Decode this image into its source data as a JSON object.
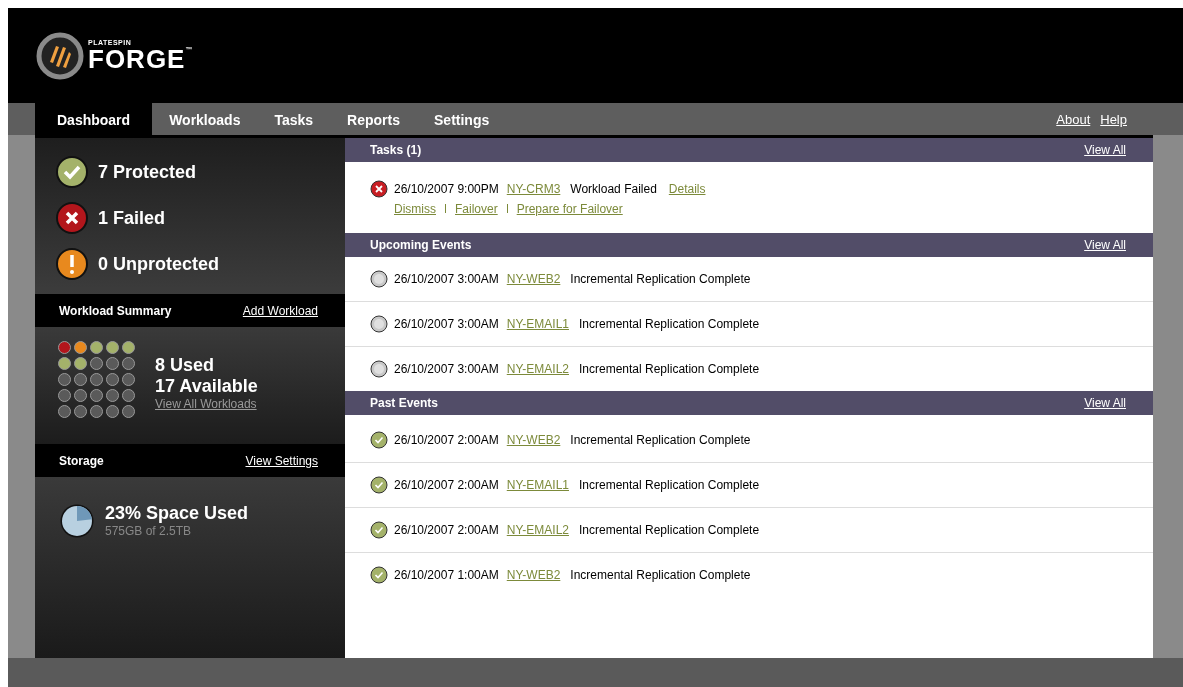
{
  "logo": {
    "maker": "PLATESPIN",
    "name": "FORGE",
    "mark": "™"
  },
  "nav": {
    "tabs": [
      {
        "label": "Dashboard",
        "selected": true
      },
      {
        "label": "Workloads",
        "selected": false
      },
      {
        "label": "Tasks",
        "selected": false
      },
      {
        "label": "Reports",
        "selected": false
      },
      {
        "label": "Settings",
        "selected": false
      }
    ],
    "links": [
      "About",
      "Help"
    ]
  },
  "status": [
    {
      "kind": "protected",
      "text": "7 Protected"
    },
    {
      "kind": "failed",
      "text": "1 Failed"
    },
    {
      "kind": "unprotected",
      "text": "0 Unprotected"
    }
  ],
  "workload_summary": {
    "title": "Workload Summary",
    "action": "Add Workload",
    "used": "8 Used",
    "available": "17 Available",
    "link": "View All Workloads",
    "slots": [
      {
        "color": "#b3161c"
      },
      {
        "color": "#e8891e"
      },
      {
        "color": "#a4b26a"
      },
      {
        "color": "#a4b26a"
      },
      {
        "color": "#a4b26a"
      },
      {
        "color": "#a4b26a"
      },
      {
        "color": "#a4b26a"
      },
      {
        "color": "#5a5a5a"
      },
      {
        "color": "#5a5a5a"
      },
      {
        "color": "#5a5a5a"
      },
      {
        "color": "#5a5a5a"
      },
      {
        "color": "#5a5a5a"
      },
      {
        "color": "#5a5a5a"
      },
      {
        "color": "#5a5a5a"
      },
      {
        "color": "#5a5a5a"
      },
      {
        "color": "#5a5a5a"
      },
      {
        "color": "#5a5a5a"
      },
      {
        "color": "#5a5a5a"
      },
      {
        "color": "#5a5a5a"
      },
      {
        "color": "#5a5a5a"
      },
      {
        "color": "#5a5a5a"
      },
      {
        "color": "#5a5a5a"
      },
      {
        "color": "#5a5a5a"
      },
      {
        "color": "#5a5a5a"
      },
      {
        "color": "#5a5a5a"
      }
    ]
  },
  "storage": {
    "title": "Storage",
    "action": "View Settings",
    "headline": "23% Space Used",
    "detail": "575GB of 2.5TB"
  },
  "sections": [
    {
      "title": "Tasks (1)",
      "action": "View All",
      "items": [
        {
          "kind": "failed",
          "time": "26/10/2007 9:00PM",
          "workload": "NY-CRM3",
          "message": "Workload Failed",
          "details": "Details",
          "actions": [
            "Dismiss",
            "Failover",
            "Prepare for Failover"
          ]
        }
      ]
    },
    {
      "title": "Upcoming Events",
      "action": "View All",
      "items": [
        {
          "kind": "scheduled",
          "time": "26/10/2007 3:00AM",
          "workload": "NY-WEB2",
          "message": "Incremental Replication Complete"
        },
        {
          "kind": "scheduled",
          "time": "26/10/2007 3:00AM",
          "workload": "NY-EMAIL1",
          "message": "Incremental Replication Complete"
        },
        {
          "kind": "scheduled",
          "time": "26/10/2007 3:00AM",
          "workload": "NY-EMAIL2",
          "message": "Incremental Replication Complete"
        }
      ]
    },
    {
      "title": "Past Events",
      "action": "View All",
      "items": [
        {
          "kind": "success",
          "time": "26/10/2007 2:00AM",
          "workload": "NY-WEB2",
          "message": "Incremental Replication Complete"
        },
        {
          "kind": "success",
          "time": "26/10/2007 2:00AM",
          "workload": "NY-EMAIL1",
          "message": "Incremental Replication Complete"
        },
        {
          "kind": "success",
          "time": "26/10/2007 2:00AM",
          "workload": "NY-EMAIL2",
          "message": "Incremental Replication Complete"
        },
        {
          "kind": "success",
          "time": "26/10/2007 1:00AM",
          "workload": "NY-WEB2",
          "message": "Incremental Replication Complete"
        }
      ]
    }
  ]
}
